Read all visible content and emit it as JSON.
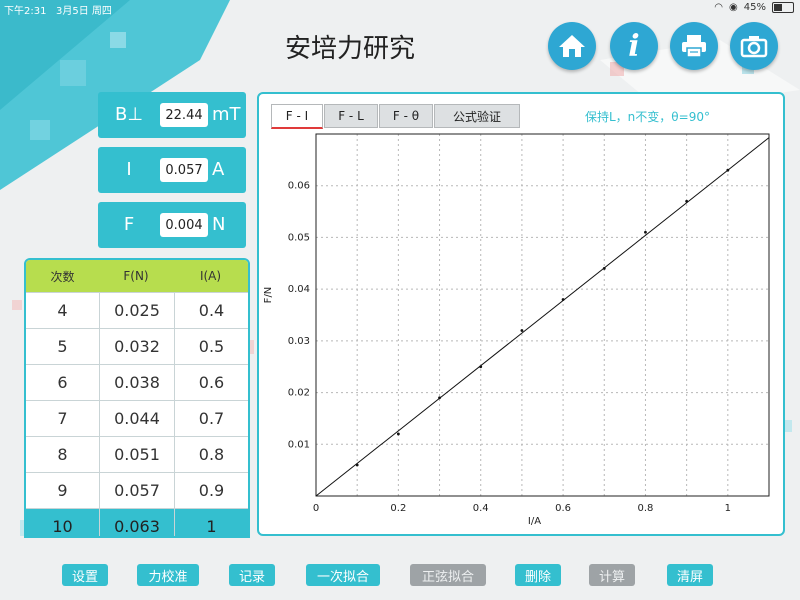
{
  "status": {
    "time": "下午2:31",
    "date": "3月5日 周四",
    "battery": "45%"
  },
  "header": {
    "title": "安培力研究"
  },
  "readouts": [
    {
      "symbol": "B⊥",
      "value": "22.44",
      "unit": "mT"
    },
    {
      "symbol": "I",
      "value": "0.057",
      "unit": "A"
    },
    {
      "symbol": "F",
      "value": "0.004",
      "unit": "N"
    }
  ],
  "table": {
    "headers": [
      "次数",
      "F(N)",
      "I(A)"
    ],
    "rows": [
      [
        "4",
        "0.025",
        "0.4"
      ],
      [
        "5",
        "0.032",
        "0.5"
      ],
      [
        "6",
        "0.038",
        "0.6"
      ],
      [
        "7",
        "0.044",
        "0.7"
      ],
      [
        "8",
        "0.051",
        "0.8"
      ],
      [
        "9",
        "0.057",
        "0.9"
      ],
      [
        "10",
        "0.063",
        "1"
      ]
    ],
    "selected_row": 6
  },
  "tabs": [
    "F - I",
    "F - L",
    "F - θ",
    "公式验证"
  ],
  "active_tab": 0,
  "hint": "保持L，n不变，θ=90°",
  "buttons": [
    {
      "label": "设置",
      "enabled": true
    },
    {
      "label": "力校准",
      "enabled": true
    },
    {
      "label": "记录",
      "enabled": true
    },
    {
      "label": "一次拟合",
      "enabled": true
    },
    {
      "label": "正弦拟合",
      "enabled": false
    },
    {
      "label": "删除",
      "enabled": true
    },
    {
      "label": "计算",
      "enabled": false
    },
    {
      "label": "清屏",
      "enabled": true
    }
  ],
  "chart_data": {
    "type": "scatter",
    "xlabel": "I/A",
    "ylabel": "F/N",
    "xlim": [
      0,
      1.1
    ],
    "ylim": [
      0,
      0.07
    ],
    "xticks": [
      0,
      0.2,
      0.4,
      0.6,
      0.8,
      1
    ],
    "yticks": [
      0.01,
      0.02,
      0.03,
      0.04,
      0.05,
      0.06
    ],
    "grid": true,
    "points": [
      {
        "x": 0.1,
        "y": 0.006
      },
      {
        "x": 0.2,
        "y": 0.012
      },
      {
        "x": 0.3,
        "y": 0.019
      },
      {
        "x": 0.4,
        "y": 0.025
      },
      {
        "x": 0.5,
        "y": 0.032
      },
      {
        "x": 0.6,
        "y": 0.038
      },
      {
        "x": 0.7,
        "y": 0.044
      },
      {
        "x": 0.8,
        "y": 0.051
      },
      {
        "x": 0.9,
        "y": 0.057
      },
      {
        "x": 1.0,
        "y": 0.063
      }
    ],
    "fit_line": {
      "slope": 0.063,
      "intercept": 0
    }
  }
}
